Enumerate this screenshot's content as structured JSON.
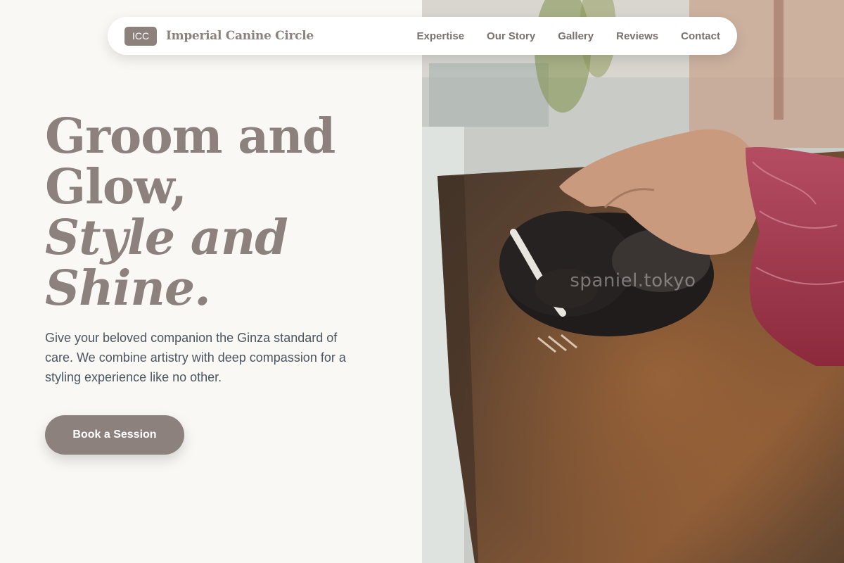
{
  "nav": {
    "logo": "ICC",
    "brand": "Imperial Canine Circle",
    "links": [
      "Expertise",
      "Our Story",
      "Gallery",
      "Reviews",
      "Contact"
    ]
  },
  "hero": {
    "title_line1": "Groom and",
    "title_line2": "Glow,",
    "title_line3": "Style and",
    "title_line4": "Shine.",
    "description": "Give your beloved companion the Ginza standard of care. We combine artistry with deep compassion for a styling experience like no other.",
    "cta": "Book a Session"
  },
  "photo": {
    "watermark": "spaniel.tokyo",
    "subject": "skunk-resting-on-wooden-table-with-hand"
  },
  "colors": {
    "accent": "#8c817d",
    "background": "#f9f8f5",
    "text": "#4a5560"
  }
}
